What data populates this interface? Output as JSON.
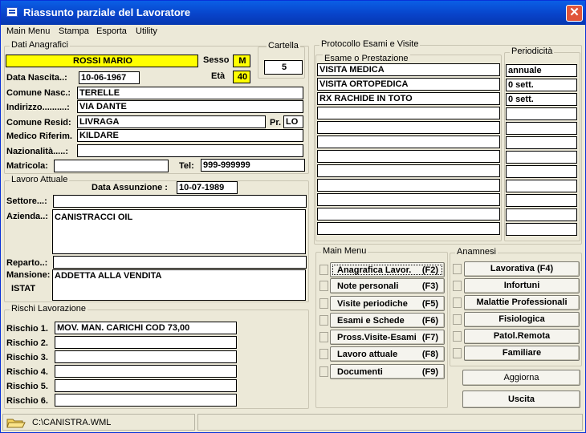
{
  "window": {
    "title": "Riassunto parziale del Lavoratore",
    "close_label": "✕"
  },
  "menu": {
    "items": [
      "Main Menu",
      "Stampa",
      "Esporta",
      "Utility"
    ]
  },
  "anagrafici": {
    "group_label": "Dati Anagrafici",
    "nome": "ROSSI MARIO",
    "sesso_label": "Sesso",
    "sesso": "M",
    "eta_label": "Età",
    "eta": "40",
    "nascita_label": "Data Nascita..:",
    "nascita": "10-06-1967",
    "comune_nasc_label": "Comune Nasc.:",
    "comune_nasc": "TERELLE",
    "indirizzo_label": "Indirizzo..........:",
    "indirizzo": "VIA DANTE",
    "comune_resid_label": "Comune Resid:",
    "comune_resid": "LIVRAGA",
    "pr_label": "Pr.",
    "pr": "LO",
    "medico_label": "Medico Riferim.",
    "medico": "KILDARE",
    "nazionalita_label": "Nazionalità.....:",
    "nazionalita": "",
    "matricola_label": "Matricola:",
    "matricola": "",
    "tel_label": "Tel:",
    "tel": "999-999999"
  },
  "cartella": {
    "label": "Cartella",
    "value": "5"
  },
  "lavoro": {
    "group_label": "Lavoro Attuale",
    "assunzione_label": "Data Assunzione :",
    "assunzione": "10-07-1989",
    "settore_label": "Settore...:",
    "settore": "",
    "azienda_label": "Azienda..:",
    "azienda": "CANISTRACCI OIL",
    "reparto_label": "Reparto..:",
    "reparto": "",
    "mansione_label": "Mansione:",
    "istat_label": "ISTAT",
    "mansione": "ADDETTA ALLA VENDITA"
  },
  "rischi": {
    "group_label": "Rischi Lavorazione",
    "items": [
      {
        "label": "Rischio 1.",
        "value": "MOV. MAN. CARICHI COD 73,00"
      },
      {
        "label": "Rischio 2.",
        "value": ""
      },
      {
        "label": "Rischio 3.",
        "value": ""
      },
      {
        "label": "Rischio 4.",
        "value": ""
      },
      {
        "label": "Rischio 5.",
        "value": ""
      },
      {
        "label": "Rischio 6.",
        "value": ""
      }
    ]
  },
  "protocollo": {
    "group_label": "Protocollo Esami e Visite",
    "col_esame": "Esame o Prestazione",
    "col_periodicita": "Periodicità",
    "rows": [
      {
        "esame": "VISITA MEDICA",
        "periodicita": "annuale"
      },
      {
        "esame": "VISITA ORTOPEDICA",
        "periodicita": "0 sett."
      },
      {
        "esame": "RX RACHIDE IN TOTO",
        "periodicita": "0 sett."
      },
      {
        "esame": "",
        "periodicita": ""
      },
      {
        "esame": "",
        "periodicita": ""
      },
      {
        "esame": "",
        "periodicita": ""
      },
      {
        "esame": "",
        "periodicita": ""
      },
      {
        "esame": "",
        "periodicita": ""
      },
      {
        "esame": "",
        "periodicita": ""
      },
      {
        "esame": "",
        "periodicita": ""
      },
      {
        "esame": "",
        "periodicita": ""
      },
      {
        "esame": "",
        "periodicita": ""
      }
    ]
  },
  "mainmenu": {
    "group_label": "Main Menu",
    "buttons": [
      {
        "label": "Anagrafica Lavor.",
        "key": "(F2)"
      },
      {
        "label": "Note personali",
        "key": "(F3)"
      },
      {
        "label": "Visite periodiche",
        "key": "(F5)"
      },
      {
        "label": "Esami e Schede",
        "key": "(F6)"
      },
      {
        "label": "Pross.Visite-Esami",
        "key": "(F7)"
      },
      {
        "label": "Lavoro attuale",
        "key": "(F8)"
      },
      {
        "label": "Documenti",
        "key": "(F9)"
      }
    ]
  },
  "anamnesi": {
    "group_label": "Anamnesi",
    "buttons": [
      "Lavorativa (F4)",
      "Infortuni",
      "Malattie Professionali",
      "Fisiologica",
      "Patol.Remota",
      "Familiare"
    ]
  },
  "actions": {
    "aggiorna": "Aggiorna",
    "uscita": "Uscita"
  },
  "status": {
    "path": "C:\\CANISTRA.WML"
  }
}
